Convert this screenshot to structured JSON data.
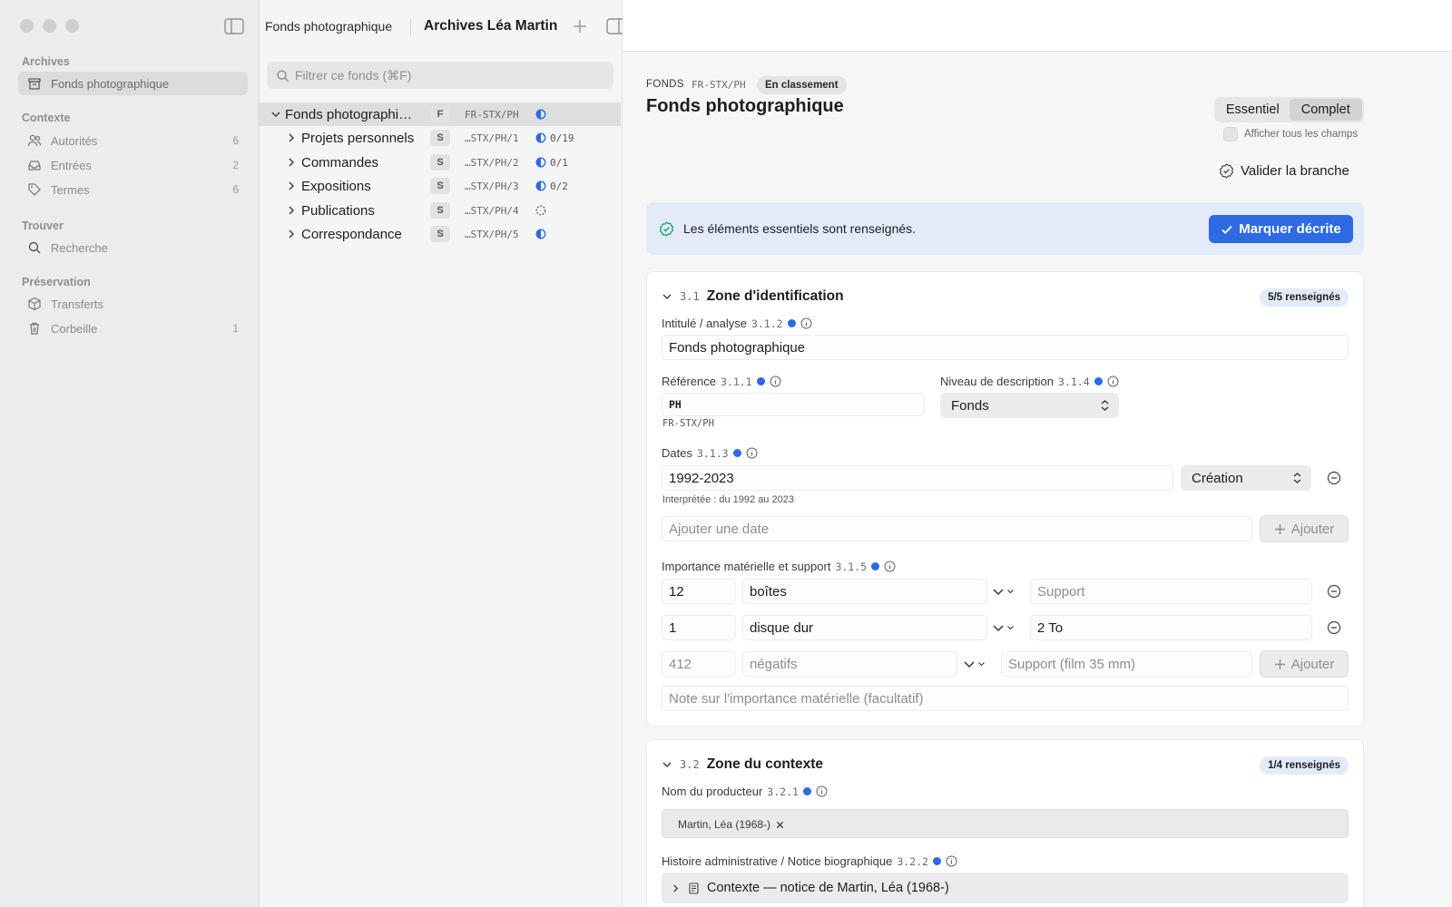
{
  "sidebar": {
    "sections": [
      {
        "title": "Archives",
        "items": [
          {
            "label": "Fonds photographique",
            "count": "",
            "icon": "archive-box-icon",
            "selected": true
          }
        ]
      },
      {
        "title": "Contexte",
        "items": [
          {
            "label": "Autorités",
            "count": "6",
            "icon": "people-icon"
          },
          {
            "label": "Entrées",
            "count": "2",
            "icon": "inbox-tray-icon"
          },
          {
            "label": "Termes",
            "count": "6",
            "icon": "tag-icon"
          }
        ]
      },
      {
        "title": "Trouver",
        "items": [
          {
            "label": "Recherche",
            "count": "",
            "icon": "magnifier-icon"
          }
        ]
      },
      {
        "title": "Préservation",
        "items": [
          {
            "label": "Transferts",
            "count": "",
            "icon": "package-icon"
          },
          {
            "label": "Corbeille",
            "count": "1",
            "icon": "trash-icon"
          }
        ]
      }
    ]
  },
  "toolbar": {
    "breadcrumb": "Fonds photographique",
    "title": "Archives Léa Martin"
  },
  "outline": {
    "search_placeholder": "Filtrer ce fonds (⌘F)",
    "rows": [
      {
        "label": "Fonds photographi…",
        "badge": "F",
        "code": "FR-STX/PH",
        "status": "",
        "status_icon": "half-circle-icon",
        "selected": true
      },
      {
        "label": "Projets personnels",
        "badge": "S",
        "code": "…STX/PH/1",
        "status": "0/19",
        "status_icon": "half-circle-icon"
      },
      {
        "label": "Commandes",
        "badge": "S",
        "code": "…STX/PH/2",
        "status": "0/1",
        "status_icon": "half-circle-icon"
      },
      {
        "label": "Expositions",
        "badge": "S",
        "code": "…STX/PH/3",
        "status": "0/2",
        "status_icon": "half-circle-icon"
      },
      {
        "label": "Publications",
        "badge": "S",
        "code": "…STX/PH/4",
        "status": "",
        "status_icon": "dashed-circle-icon"
      },
      {
        "label": "Correspondance",
        "badge": "S",
        "code": "…STX/PH/5",
        "status": "",
        "status_icon": "half-circle-icon"
      }
    ]
  },
  "record": {
    "type": "FONDS",
    "code": "FR-STX/PH",
    "status": "En classement",
    "title": "Fonds photographique",
    "view_modes": [
      "Essentiel",
      "Complet"
    ],
    "active_mode": "Complet",
    "show_all_label": "Afficher tous les champs",
    "validate_label": "Valider la branche",
    "banner_text": "Les éléments essentiels sont renseignés.",
    "mark_button": "Marquer décrite"
  },
  "zone1": {
    "num": "3.1",
    "title": "Zone d'identification",
    "filled": "5/5 renseignés",
    "title_field": {
      "label": "Intitulé / analyse",
      "num": "3.1.2",
      "value": "Fonds photographique"
    },
    "reference": {
      "label": "Référence",
      "num": "3.1.1",
      "value": "PH",
      "full": "FR-STX/PH"
    },
    "level": {
      "label": "Niveau de description",
      "num": "3.1.4",
      "value": "Fonds"
    },
    "dates": {
      "label": "Dates",
      "num": "3.1.3",
      "value": "1992-2023",
      "type": "Création",
      "interpreted": "Interprétée : du 1992 au 2023",
      "add_placeholder": "Ajouter une date",
      "add_label": "Ajouter"
    },
    "extent": {
      "label": "Importance matérielle et support",
      "num": "3.1.5",
      "rows": [
        {
          "qty": "12",
          "unit": "boîtes",
          "support": "",
          "support_placeholder": "Support"
        },
        {
          "qty": "1",
          "unit": "disque dur",
          "support": "2 To",
          "support_placeholder": ""
        }
      ],
      "new_row": {
        "qty_placeholder": "412",
        "unit_placeholder": "négatifs",
        "support_placeholder": "Support (film 35 mm)"
      },
      "add_label": "Ajouter",
      "note_placeholder": "Note sur l'importance matérielle (facultatif)"
    }
  },
  "zone2": {
    "num": "3.2",
    "title": "Zone du contexte",
    "filled": "1/4 renseignés",
    "producer": {
      "label": "Nom du producteur",
      "num": "3.2.1",
      "token": "Martin, Léa (1968-)"
    },
    "history": {
      "label": "Histoire administrative / Notice biographique",
      "num": "3.2.2",
      "ref": "Contexte — notice de Martin, Léa (1968-)"
    }
  },
  "colors": {
    "accent": "#2d6ae3",
    "banner": "#e3ebfb"
  }
}
